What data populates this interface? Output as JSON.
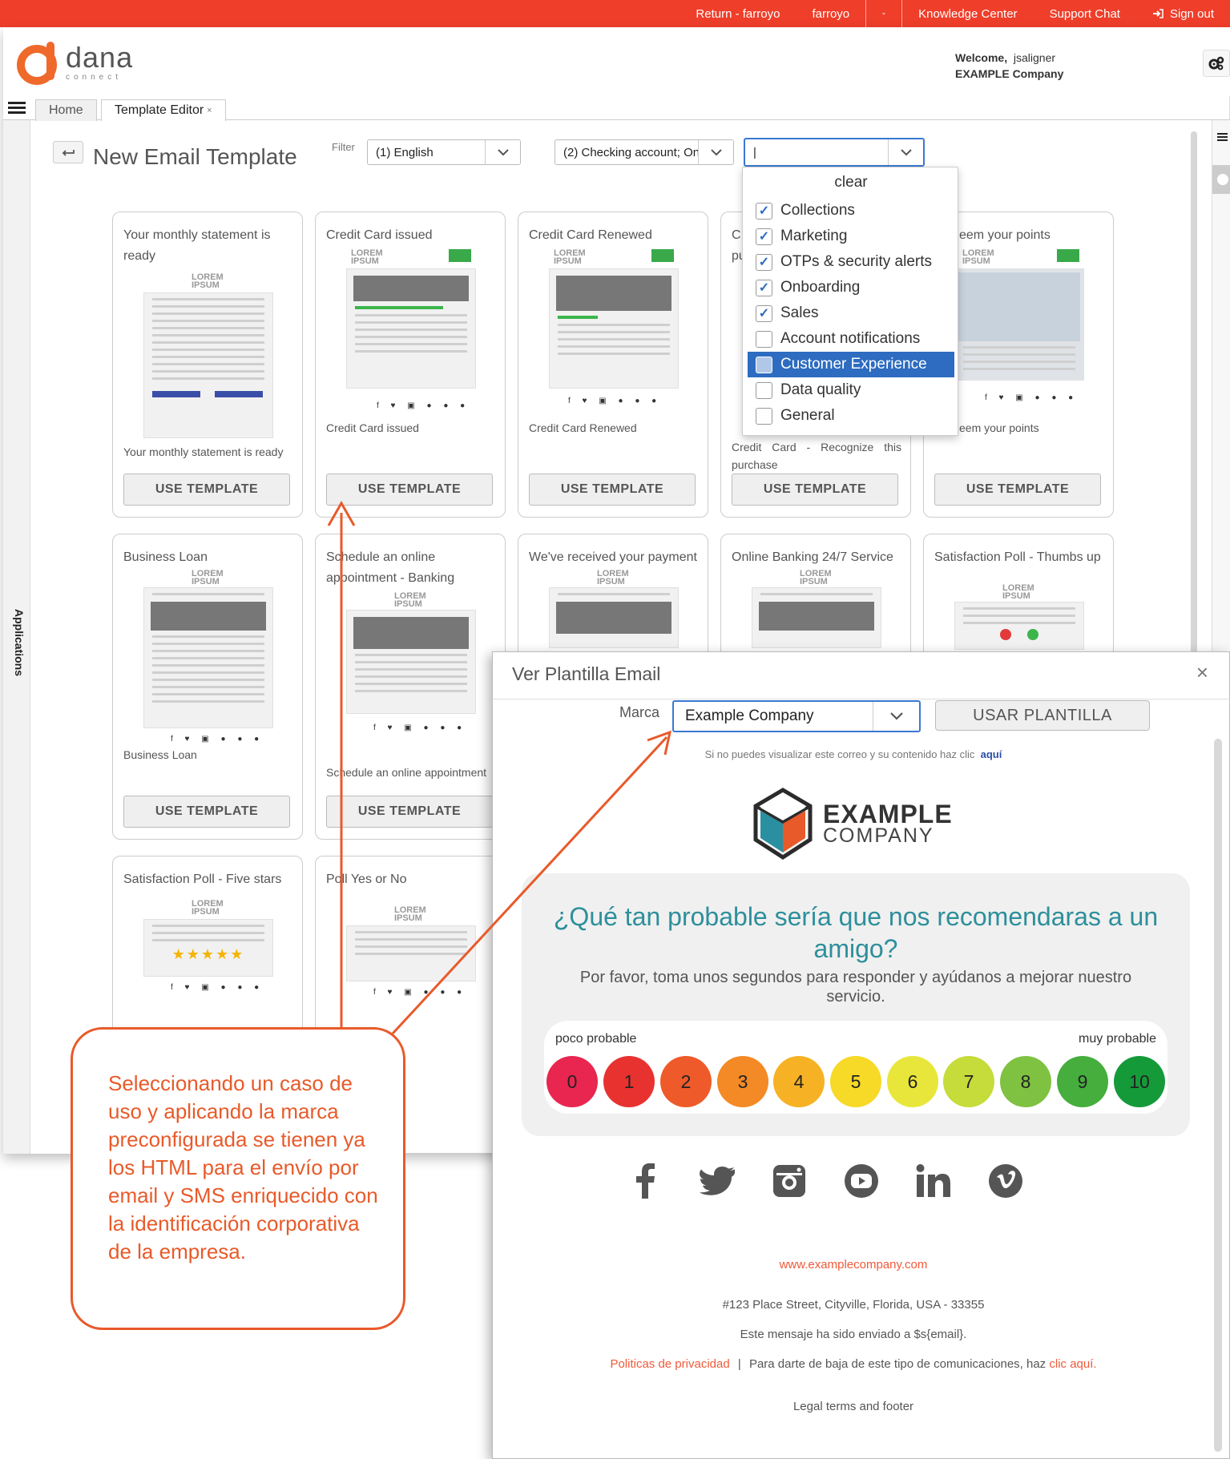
{
  "topbar": {
    "return_label": "Return - farroyo",
    "user": "farroyo",
    "knowledge": "Knowledge Center",
    "support": "Support Chat",
    "signout": "Sign out"
  },
  "brand": {
    "name": "dana",
    "tagline": "connect"
  },
  "welcome": {
    "label": "Welcome,",
    "user": "jsaligner",
    "company": "EXAMPLE Company"
  },
  "tabs": [
    {
      "label": "Home"
    },
    {
      "label": "Template Editor"
    }
  ],
  "tab_close": "×",
  "sidebar_label": "Applications",
  "page": {
    "title": "New Email Template",
    "filter_label": "Filter"
  },
  "filters": {
    "language": "(1) English",
    "product": "(2) Checking account; On",
    "category": "|"
  },
  "dropdown": {
    "clear": "clear",
    "options": [
      {
        "label": "Collections",
        "checked": true
      },
      {
        "label": "Marketing",
        "checked": true
      },
      {
        "label": "OTPs & security alerts",
        "checked": true
      },
      {
        "label": "Onboarding",
        "checked": true
      },
      {
        "label": "Sales",
        "checked": true
      },
      {
        "label": "Account notifications",
        "checked": false
      },
      {
        "label": "Customer Experience",
        "checked": false,
        "highlighted": true
      },
      {
        "label": "Data quality",
        "checked": false
      },
      {
        "label": "General",
        "checked": false
      }
    ]
  },
  "cards": {
    "use_label": "USE TEMPLATE",
    "lorem": "LOREM",
    "ipsum": "IPSUM",
    "row1": [
      {
        "title": "Your monthly statement is ready",
        "subtitle": "Your monthly statement is ready"
      },
      {
        "title": "Credit Card issued",
        "subtitle": "Credit Card issued"
      },
      {
        "title": "Credit Card Renewed",
        "subtitle": "Credit Card Renewed"
      },
      {
        "title": "C",
        "title2": "pu",
        "subtitle": "Credit Card - Recognize this purchase"
      },
      {
        "title": "eem your points",
        "subtitle": "eem your points"
      }
    ],
    "row2": [
      {
        "title": "Business Loan",
        "subtitle": "Business Loan"
      },
      {
        "title": "Schedule an online appointment - Banking",
        "subtitle": "Schedule an online appointment"
      },
      {
        "title": "We've received your payment"
      },
      {
        "title": "Online Banking 24/7 Service"
      },
      {
        "title": "Satisfaction Poll - Thumbs up"
      }
    ],
    "row3": [
      {
        "title": "Satisfaction Poll - Five stars"
      },
      {
        "title": "Poll Yes or No"
      }
    ]
  },
  "modal": {
    "title": "Ver Plantilla Email",
    "close": "×",
    "brand_label": "Marca",
    "brand_value": "Example Company",
    "use_button": "USAR PLANTILLA",
    "no_view_text": "Si no puedes visualizar este correo y su contenido haz clic",
    "no_view_link": "aquí",
    "company_line1": "EXAMPLE",
    "company_line2": "COMPANY",
    "nps_question": "¿Qué tan probable sería que nos recomendaras a un amigo?",
    "nps_sub": "Por favor, toma unos segundos para responder y ayúdanos a mejorar nuestro servicio.",
    "low_label": "poco probable",
    "high_label": "muy probable",
    "scale": [
      "0",
      "1",
      "2",
      "3",
      "4",
      "5",
      "6",
      "7",
      "8",
      "9",
      "10"
    ],
    "scale_colors": [
      "#e8264f",
      "#e8322f",
      "#ee5a2a",
      "#f38a25",
      "#f6b224",
      "#f7d927",
      "#e8e63a",
      "#c5dc3a",
      "#7fc242",
      "#45ae3d",
      "#159a3a"
    ],
    "social": [
      "facebook-icon",
      "twitter-icon",
      "instagram-icon",
      "youtube-icon",
      "linkedin-icon",
      "vimeo-icon"
    ],
    "website": "www.examplecompany.com",
    "address": "#123 Place Street, Cityville, Florida, USA - 33355",
    "sent_to": "Este mensaje ha sido enviado a $s{email}.",
    "privacy": "Politicas de privacidad",
    "divider": "|",
    "unsubscribe_text": "Para darte de baja de este tipo de comunicaciones, haz",
    "unsubscribe_link": "clic aquí.",
    "legal": "Legal terms and footer"
  },
  "callout": {
    "text": "Seleccionando un caso de uso y aplicando la marca preconfigurada se tienen ya los HTML para el envío por email y SMS enriquecido con la identificación corporativa de la empresa."
  },
  "colors": {
    "topbar": "#ef3e2a",
    "accent": "#e85a2a",
    "select": "#2d6cc0",
    "teal": "#2d8f9b"
  }
}
